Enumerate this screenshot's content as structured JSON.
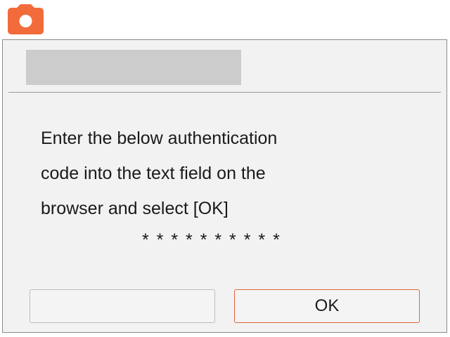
{
  "app": {
    "icon": "camera-icon",
    "accent_color": "#f26b3a"
  },
  "dialog": {
    "title": "",
    "message": "Enter the below authentication\ncode into the text field on the\nbrowser and select [OK]",
    "auth_code": "**********",
    "auth_code_display": "* * * * * * * * * *",
    "left_button_label": "",
    "ok_button_label": "OK"
  }
}
